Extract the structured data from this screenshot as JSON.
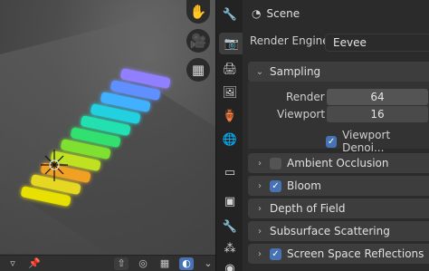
{
  "viewport": {
    "tools": [
      {
        "icon": "hand-icon",
        "glyph": "✋"
      },
      {
        "icon": "camera-icon",
        "glyph": "🎥"
      },
      {
        "icon": "grid-icon",
        "glyph": "▦"
      }
    ],
    "header_buttons": [
      {
        "icon": "triangle-down-icon",
        "glyph": "▿"
      },
      {
        "icon": "pin-icon",
        "glyph": "📌"
      },
      {
        "icon": "arrow-up-icon",
        "glyph": "⇧"
      },
      {
        "icon": "swirl-icon",
        "glyph": "◎"
      },
      {
        "icon": "grid-select-icon",
        "glyph": "▦"
      },
      {
        "icon": "globe-shading-icon",
        "glyph": "◐"
      },
      {
        "icon": "chevron-down-icon",
        "glyph": "⌄"
      }
    ]
  },
  "tabs": [
    {
      "name": "tab-tool",
      "glyph": "🔧"
    },
    {
      "name": "tab-render",
      "glyph": "📷"
    },
    {
      "name": "tab-output",
      "glyph": "🖨"
    },
    {
      "name": "tab-view-layer",
      "glyph": "🖼"
    },
    {
      "name": "tab-scene",
      "glyph": "🏺"
    },
    {
      "name": "tab-world",
      "glyph": "🌐"
    },
    {
      "name": "tab-collection",
      "glyph": "▭"
    },
    {
      "name": "tab-object",
      "glyph": "▣"
    },
    {
      "name": "tab-modifiers",
      "glyph": "🔧"
    },
    {
      "name": "tab-particles",
      "glyph": "⁂"
    },
    {
      "name": "tab-physics",
      "glyph": "◉"
    }
  ],
  "properties": {
    "context_title": "Scene",
    "render_engine_label": "Render Engine",
    "render_engine_value": "Eevee",
    "sampling": {
      "title": "Sampling",
      "render_label": "Render",
      "render_value": "64",
      "viewport_label": "Viewport",
      "viewport_value": "16",
      "viewport_denoise_label": "Viewport Denoi...",
      "viewport_denoise_checked": true
    },
    "sections": [
      {
        "label": "Ambient Occlusion",
        "has_checkbox": true,
        "checked": false
      },
      {
        "label": "Bloom",
        "has_checkbox": true,
        "checked": true
      },
      {
        "label": "Depth of Field",
        "has_checkbox": false,
        "checked": false
      },
      {
        "label": "Subsurface Scattering",
        "has_checkbox": false,
        "checked": false
      },
      {
        "label": "Screen Space Reflections",
        "has_checkbox": true,
        "checked": true
      }
    ]
  },
  "colors": {
    "accent": "#4772b3",
    "panel_bg": "#2b2b2b",
    "section_bg": "#3d3d3d"
  }
}
